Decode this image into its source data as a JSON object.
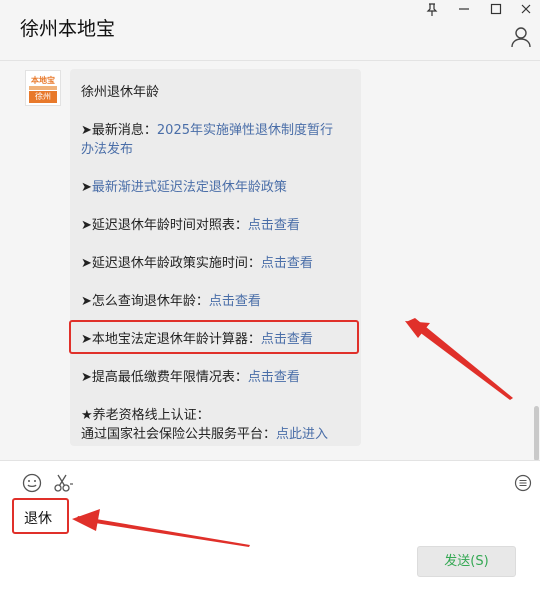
{
  "window": {
    "title": "徐州本地宝"
  },
  "sender": {
    "logo_top": "本地宝",
    "logo_bottom": "徐州"
  },
  "message": {
    "heading": "徐州退休年龄",
    "items": [
      {
        "prefix": "➤最新消息：",
        "link": "2025年实施弹性退休制度暂行"
      },
      {
        "prefix": "",
        "link": "办法发布"
      },
      {
        "prefix": "➤",
        "link": "最新渐进式延迟法定退休年龄政策"
      },
      {
        "prefix": "➤延迟退休年龄时间对照表：",
        "link": "点击查看"
      },
      {
        "prefix": "➤延迟退休年龄政策实施时间：",
        "link": "点击查看"
      },
      {
        "prefix": "➤怎么查询退休年龄：",
        "link": "点击查看"
      },
      {
        "prefix": "➤本地宝法定退休年龄计算器：",
        "link": "点击查看"
      },
      {
        "prefix": "➤提高最低缴费年限情况表：",
        "link": "点击查看"
      },
      {
        "prefix": "★养老资格线上认证：",
        "link": ""
      },
      {
        "prefix": "通过国家社会保险公共服务平台：",
        "link": "点此进入"
      }
    ]
  },
  "input": {
    "text": "退休"
  },
  "send_button": {
    "label": "发送(S)"
  },
  "colors": {
    "link": "#4a6ea8",
    "highlight": "#e0302a",
    "send_text": "#34a853"
  }
}
